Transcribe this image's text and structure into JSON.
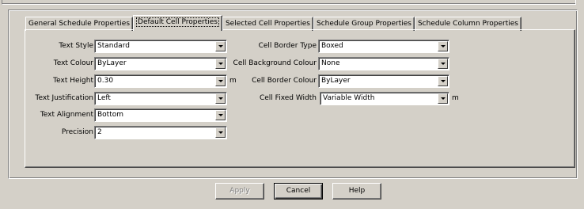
{
  "tabs": [
    {
      "label": "General Schedule Properties"
    },
    {
      "label": "Default Cell Properties"
    },
    {
      "label": "Selected Cell Properties"
    },
    {
      "label": "Schedule Group Properties"
    },
    {
      "label": "Schedule Column Properties"
    }
  ],
  "active_tab": "Default Cell Properties",
  "left_fields": [
    {
      "label": "Text Style",
      "value": "Standard"
    },
    {
      "label": "Text Colour",
      "value": "ByLayer"
    },
    {
      "label": "Text Height",
      "value": "0.30",
      "unit": "m"
    },
    {
      "label": "Text Justification",
      "value": "Left"
    },
    {
      "label": "Text Alignment",
      "value": "Bottom"
    },
    {
      "label": "Precision",
      "value": "2"
    }
  ],
  "right_fields": [
    {
      "label": "Cell Border Type",
      "value": "Boxed"
    },
    {
      "label": "Cell Background Colour",
      "value": "None"
    },
    {
      "label": "Cell Border Colour",
      "value": "ByLayer"
    },
    {
      "label": "Cell Fixed Width",
      "value": "Variable Width",
      "unit": "m"
    }
  ],
  "buttons": {
    "apply": "Apply",
    "cancel": "Cancel",
    "help": "Help"
  }
}
